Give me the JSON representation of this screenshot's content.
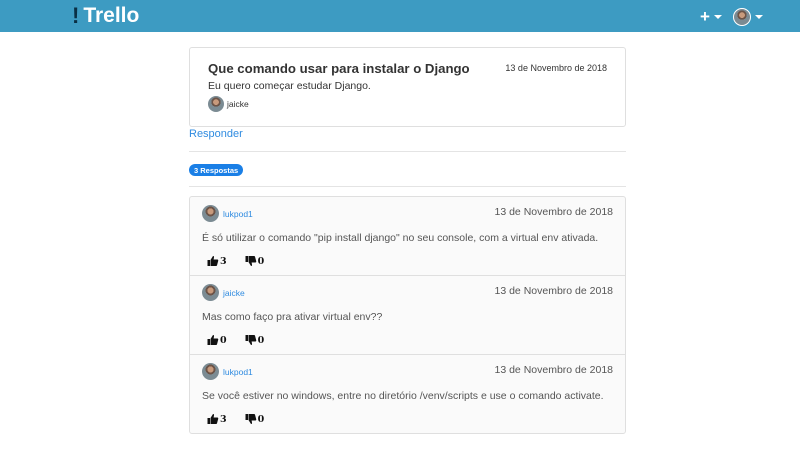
{
  "navbar": {
    "brand_mark": "!",
    "brand_name": "Trello",
    "add_symbol": "+",
    "add_icon": "plus-icon",
    "user_avatar_icon": "user-avatar-icon"
  },
  "question": {
    "title": "Que comando usar para instalar o Django",
    "date": "13 de Novembro de 2018",
    "body": "Eu quero começar estudar Django.",
    "author": "jaicke"
  },
  "reply_label": "Responder",
  "answers_badge": "3 Respostas",
  "answers": [
    {
      "author": "lukpod1",
      "date": "13 de Novembro de 2018",
      "text": "É só utilizar o comando \"pip install django\" no seu console, com a virtual env ativada.",
      "upvotes": "3",
      "downvotes": "0"
    },
    {
      "author": "jaicke",
      "date": "13 de Novembro de 2018",
      "text": "Mas como faço pra ativar virtual env??",
      "upvotes": "0",
      "downvotes": "0"
    },
    {
      "author": "lukpod1",
      "date": "13 de Novembro de 2018",
      "text": "Se você estiver no windows, entre no diretório /venv/scripts e use o comando activate.",
      "upvotes": "3",
      "downvotes": "0"
    }
  ],
  "colors": {
    "navbar": "#3d9bc2",
    "link": "#2f8be0",
    "badge": "#1a7fe6"
  }
}
